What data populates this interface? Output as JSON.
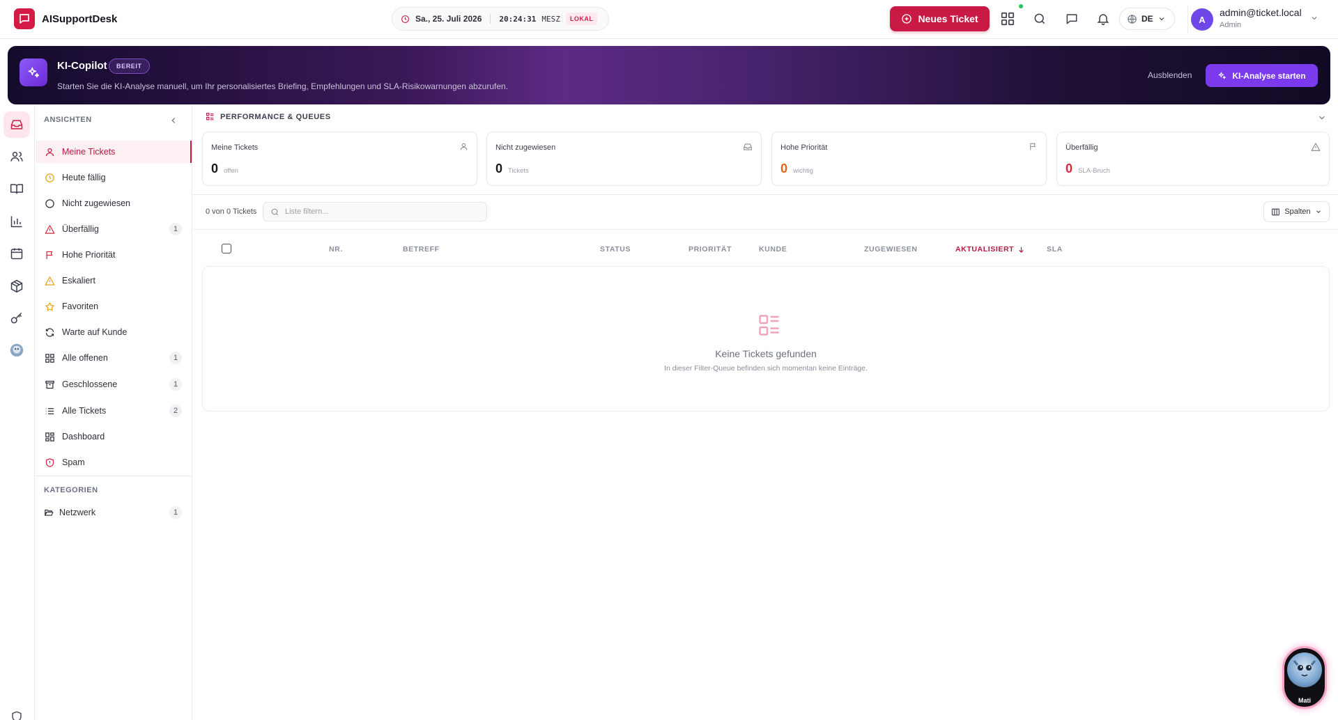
{
  "app": {
    "name": "AISupportDesk"
  },
  "clock": {
    "date": "Sa., 25. Juli 2026",
    "time": "20:24:31",
    "tz": "MESZ",
    "badge": "LOKAL"
  },
  "header": {
    "new_ticket_label": "Neues Ticket",
    "language": "DE",
    "user": {
      "initial": "A",
      "email": "admin@ticket.local",
      "role": "Admin"
    }
  },
  "banner": {
    "title": "KI-Copilot",
    "badge": "BEREIT",
    "description": "Starten Sie die KI-Analyse manuell, um Ihr personalisiertes Briefing, Empfehlungen und SLA-Risikowarnungen abzurufen.",
    "hide_label": "Ausblenden",
    "start_label": "KI-Analyse starten",
    "accent_color": "#7c3aed"
  },
  "sidebar": {
    "views_heading": "ANSICHTEN",
    "items": [
      {
        "label": "Meine Tickets",
        "icon": "user-icon",
        "count": ""
      },
      {
        "label": "Heute fällig",
        "icon": "clock-icon",
        "count": ""
      },
      {
        "label": "Nicht zugewiesen",
        "icon": "circle-icon",
        "count": ""
      },
      {
        "label": "Überfällig",
        "icon": "warning-icon",
        "count": "1"
      },
      {
        "label": "Hohe Priorität",
        "icon": "flag-icon",
        "count": ""
      },
      {
        "label": "Eskaliert",
        "icon": "alert-triangle-icon",
        "count": ""
      },
      {
        "label": "Favoriten",
        "icon": "star-icon",
        "count": ""
      },
      {
        "label": "Warte auf Kunde",
        "icon": "refresh-icon",
        "count": ""
      },
      {
        "label": "Alle offenen",
        "icon": "grid-icon",
        "count": "1"
      },
      {
        "label": "Geschlossene",
        "icon": "archive-icon",
        "count": "1"
      },
      {
        "label": "Alle Tickets",
        "icon": "list-icon",
        "count": "2"
      },
      {
        "label": "Dashboard",
        "icon": "dashboard-icon",
        "count": ""
      },
      {
        "label": "Spam",
        "icon": "shield-alert-icon",
        "count": ""
      }
    ],
    "categories_heading": "KATEGORIEN",
    "categories": [
      {
        "label": "Netzwerk",
        "icon": "folder-open-icon",
        "count": "1"
      }
    ]
  },
  "performance": {
    "heading": "PERFORMANCE & QUEUES",
    "cards": [
      {
        "label": "Meine Tickets",
        "value": "0",
        "sub": "offen",
        "icon": "user-icon"
      },
      {
        "label": "Nicht zugewiesen",
        "value": "0",
        "sub": "Tickets",
        "icon": "inbox-icon"
      },
      {
        "label": "Hohe Priorität",
        "value": "0",
        "sub": "wichtig",
        "icon": "flag-icon",
        "color": "#e8621a"
      },
      {
        "label": "Überfällig",
        "value": "0",
        "sub": "SLA-Bruch",
        "icon": "warning-icon",
        "color": "#d7263d"
      }
    ]
  },
  "toolbar": {
    "count_text": "0 von 0 Tickets",
    "filter_placeholder": "Liste filtern...",
    "columns_label": "Spalten"
  },
  "table": {
    "columns": [
      "NR.",
      "BETREFF",
      "STATUS",
      "PRIORITÄT",
      "KUNDE",
      "ZUGEWIESEN",
      "AKTUALISIERT",
      "SLA"
    ],
    "sorted_column": "AKTUALISIERT",
    "empty_title": "Keine Tickets gefunden",
    "empty_subtitle": "In dieser Filter-Queue befinden sich momentan keine Einträge."
  },
  "mascot": {
    "name": "Mati"
  }
}
